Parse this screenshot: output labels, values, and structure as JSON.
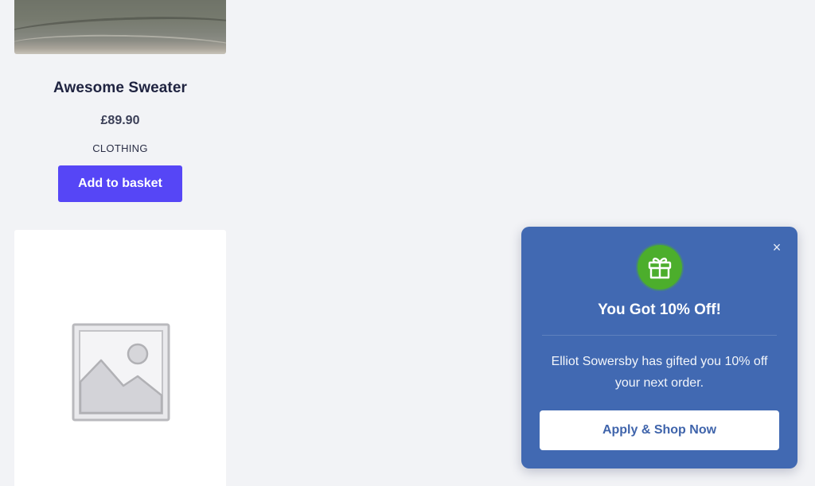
{
  "products": [
    {
      "title": "Awesome Sweater",
      "price": "£89.90",
      "category": "CLOTHING",
      "button_label": "Add to basket",
      "image": "sweater-photo"
    },
    {
      "image": "placeholder-image-icon"
    }
  ],
  "popup": {
    "icon": "gift-icon",
    "close_icon": "close-icon",
    "close_label": "×",
    "title": "You Got 10% Off!",
    "message": "Elliot Sowersby has gifted you 10% off your next order.",
    "button_label": "Apply & Shop Now",
    "colors": {
      "background": "#4169b2",
      "badge": "#4cae2c",
      "button_text": "#3f64ab"
    }
  },
  "colors": {
    "page_background": "#f2f3f6",
    "primary_button": "#5646f6"
  }
}
